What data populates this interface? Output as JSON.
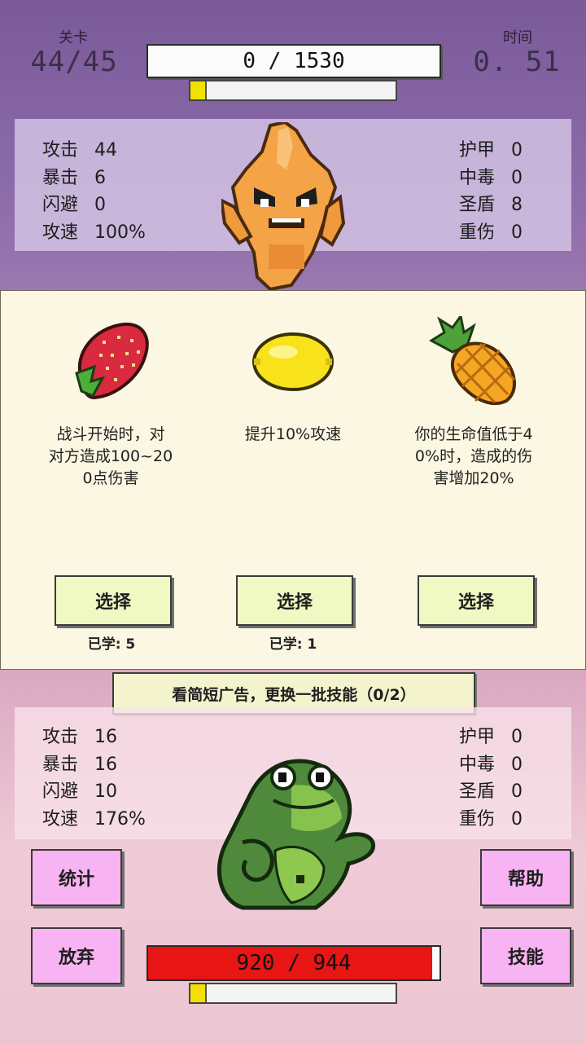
{
  "header": {
    "level_label": "关卡",
    "level_value": "44/45",
    "time_label": "时间",
    "time_value": "0. 51",
    "enemy_hp_text": "0 / 1530"
  },
  "enemy": {
    "stats_left": [
      {
        "label": "攻击",
        "value": "44"
      },
      {
        "label": "暴击",
        "value": "6"
      },
      {
        "label": "闪避",
        "value": "0"
      },
      {
        "label": "攻速",
        "value": "100%"
      }
    ],
    "stats_right": [
      {
        "label": "护甲",
        "value": "0"
      },
      {
        "label": "中毒",
        "value": "0"
      },
      {
        "label": "圣盾",
        "value": "8"
      },
      {
        "label": "重伤",
        "value": "0"
      }
    ],
    "hp_current": 0,
    "hp_max": 1530,
    "charge_fraction": 0.07
  },
  "skills": [
    {
      "icon": "strawberry-icon",
      "desc_lines": [
        "战斗开始时，对",
        "对方造成100~20",
        "0点伤害"
      ],
      "button": "选择",
      "learned": "已学: 5"
    },
    {
      "icon": "lemon-icon",
      "desc_lines": [
        "提升10%攻速"
      ],
      "button": "选择",
      "learned": "已学: 1"
    },
    {
      "icon": "pineapple-icon",
      "desc_lines": [
        "你的生命值低于4",
        "0%时，造成的伤",
        "害增加20%"
      ],
      "button": "选择",
      "learned": ""
    }
  ],
  "ad_refresh": "看简短广告，更换一批技能（0/2）",
  "player": {
    "stats_left": [
      {
        "label": "攻击",
        "value": "16"
      },
      {
        "label": "暴击",
        "value": "16"
      },
      {
        "label": "闪避",
        "value": "10"
      },
      {
        "label": "攻速",
        "value": "176%"
      }
    ],
    "stats_right": [
      {
        "label": "护甲",
        "value": "0"
      },
      {
        "label": "中毒",
        "value": "0"
      },
      {
        "label": "圣盾",
        "value": "0"
      },
      {
        "label": "重伤",
        "value": "0"
      }
    ],
    "hp_text": "920 / 944",
    "hp_current": 920,
    "hp_max": 944,
    "charge_fraction": 0.07
  },
  "buttons": {
    "stats": "统计",
    "help": "帮助",
    "give_up": "放弃",
    "skills": "技能"
  },
  "colors": {
    "hp_red": "#e81515",
    "charge_yellow": "#f2e000",
    "button_pink": "#f8b3f3",
    "button_green": "#f0f8c4"
  }
}
